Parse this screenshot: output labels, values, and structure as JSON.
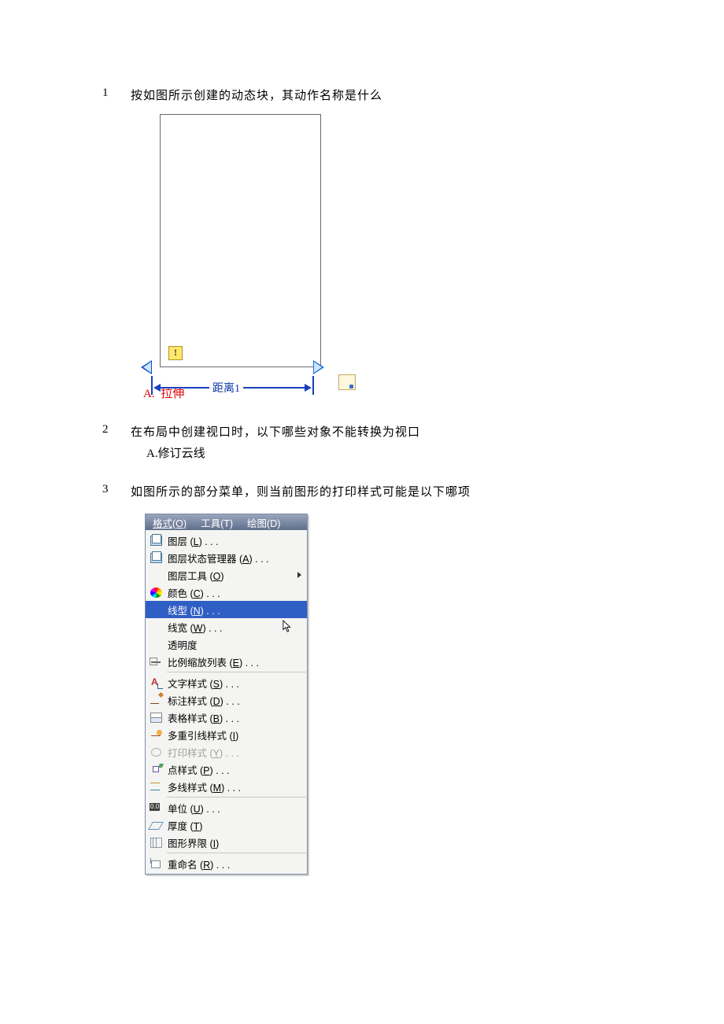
{
  "q1": {
    "num": "1",
    "text": "按如图所示创建的动态块，其动作名称是什么",
    "distance_label": "距离1",
    "answer_label": "A.",
    "answer_text": "拉伸"
  },
  "q2": {
    "num": "2",
    "text": "在布局中创建视口时，以下哪些对象不能转换为视口",
    "answer": "A.修订云线"
  },
  "q3": {
    "num": "3",
    "text": "如图所示的部分菜单，则当前图形的打印样式可能是以下哪项"
  },
  "menu": {
    "title_tabs": [
      "格式(O)",
      "工具(T)",
      "绘图(D)"
    ],
    "groups": [
      [
        {
          "label": "图层 (L) . . .",
          "icon": "ic-layer"
        },
        {
          "label": "图层状态管理器 (A) . . .",
          "icon": "ic-layer"
        },
        {
          "label": "图层工具 (O)",
          "icon": "",
          "submenu": true
        },
        {
          "label": "颜色 (C) . . .",
          "icon": "ic-color"
        },
        {
          "label": "线型 (N) . . .",
          "icon": "",
          "hover": true
        },
        {
          "label": "线宽 (W) . . .",
          "icon": ""
        },
        {
          "label": "透明度",
          "icon": ""
        },
        {
          "label": "比例缩放列表 (E) . . .",
          "icon": "ic-scale"
        }
      ],
      [
        {
          "label": "文字样式 (S) . . .",
          "icon": "ic-text"
        },
        {
          "label": "标注样式 (D) . . .",
          "icon": "ic-dim"
        },
        {
          "label": "表格样式 (B) . . .",
          "icon": "ic-table"
        },
        {
          "label": "多重引线样式 (I)",
          "icon": "ic-mlead"
        },
        {
          "label": "打印样式 (Y) . . .",
          "icon": "ic-print",
          "disabled": true
        },
        {
          "label": "点样式 (P) . . .",
          "icon": "ic-point"
        },
        {
          "label": "多线样式 (M) . . .",
          "icon": "ic-mline"
        }
      ],
      [
        {
          "label": "单位 (U) . . .",
          "icon": "ic-unit"
        },
        {
          "label": "厚度 (T)",
          "icon": "ic-thick"
        },
        {
          "label": "图形界限 (I)",
          "icon": "ic-limit"
        }
      ],
      [
        {
          "label": "重命名 (R) . . .",
          "icon": "ic-rename"
        }
      ]
    ]
  }
}
